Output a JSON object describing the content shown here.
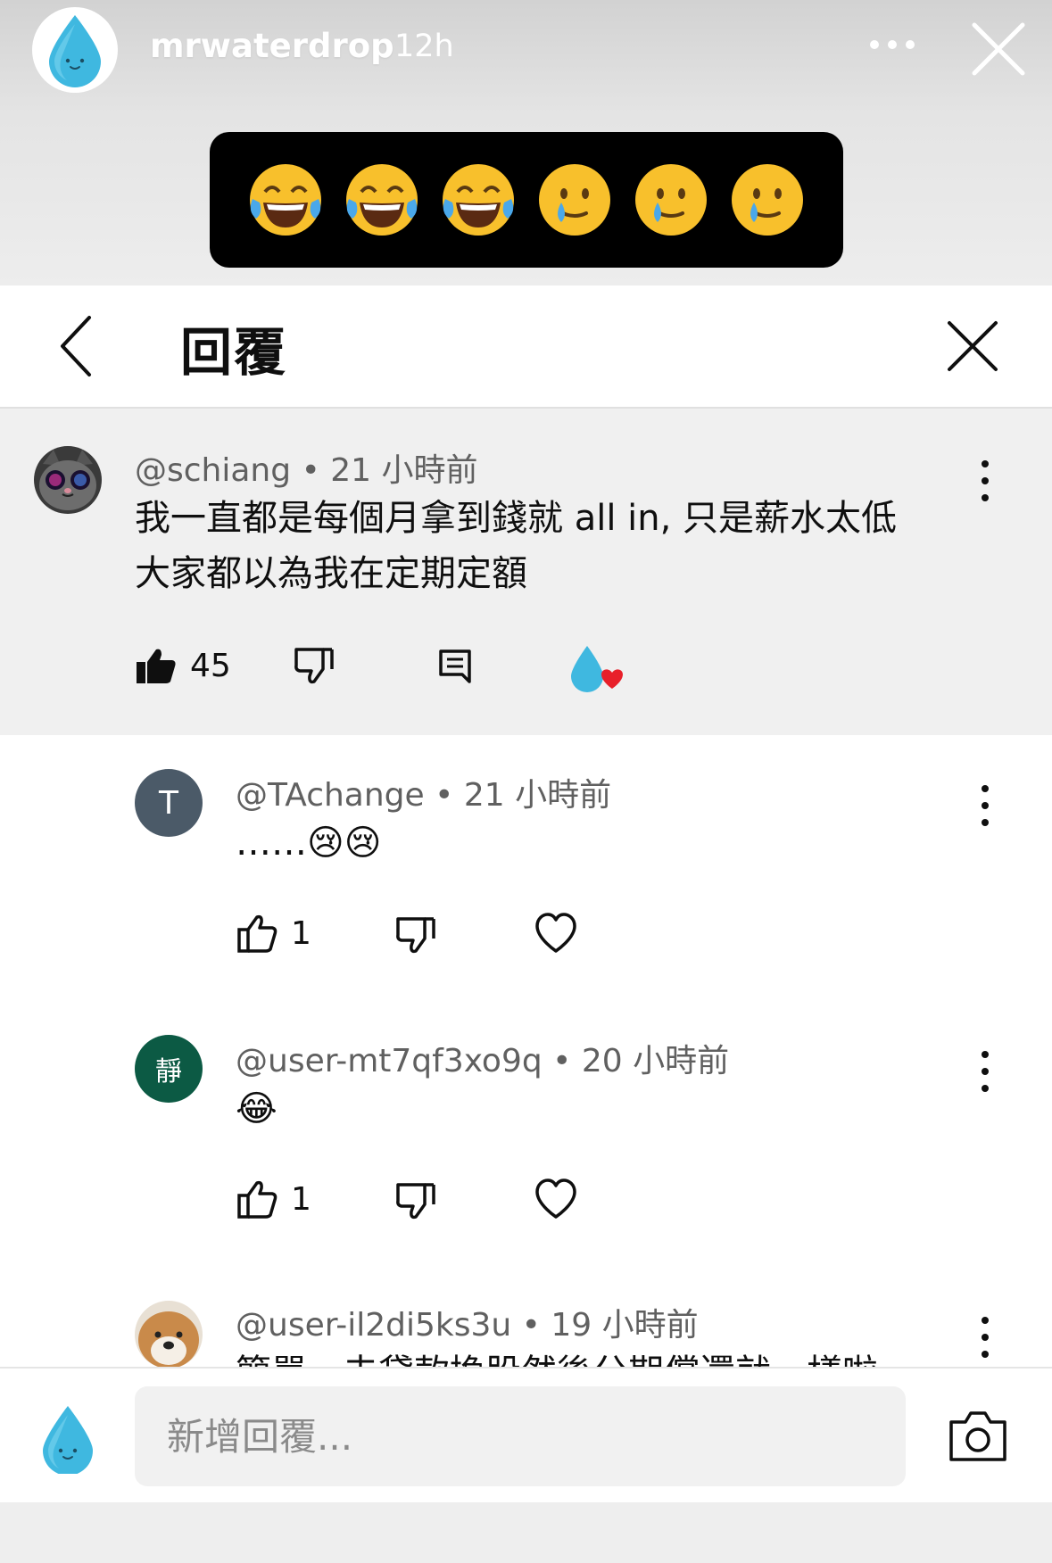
{
  "story": {
    "username": "mrwaterdrop",
    "time": "12h",
    "emojis": [
      "😂",
      "😂",
      "😂",
      "🥲",
      "🥲",
      "🥲"
    ]
  },
  "panel": {
    "title": "回覆"
  },
  "main_comment": {
    "user": "@schiang",
    "time": "21 小時前",
    "text_line1": "我一直都是每個月拿到錢就 all in, 只是薪水太低",
    "text_line2": "大家都以為我在定期定額",
    "likes": "45"
  },
  "replies": [
    {
      "user": "@TAchange",
      "time": "21 小時前",
      "avatar_letter": "T",
      "avatar_color": "#4b5a68",
      "text": "……😢😢",
      "likes": "1"
    },
    {
      "user": "@user-mt7qf3xo9q",
      "time": "20 小時前",
      "avatar_letter": "靜",
      "avatar_color": "#0c5a44",
      "text": "😂",
      "likes": "1"
    },
    {
      "user": "@user-il2di5ks3u",
      "time": "19 小時前",
      "avatar_letter": "",
      "avatar_color": "#c98a4a",
      "text": "簡單，去貸款換股然後分期償還就一樣啦"
    }
  ],
  "composer": {
    "placeholder": "新增回覆..."
  },
  "colors": {
    "accent_blue": "#3fb8e0",
    "heart_red": "#e8202a",
    "text_primary": "#0f0f0f",
    "text_secondary": "#606060"
  }
}
